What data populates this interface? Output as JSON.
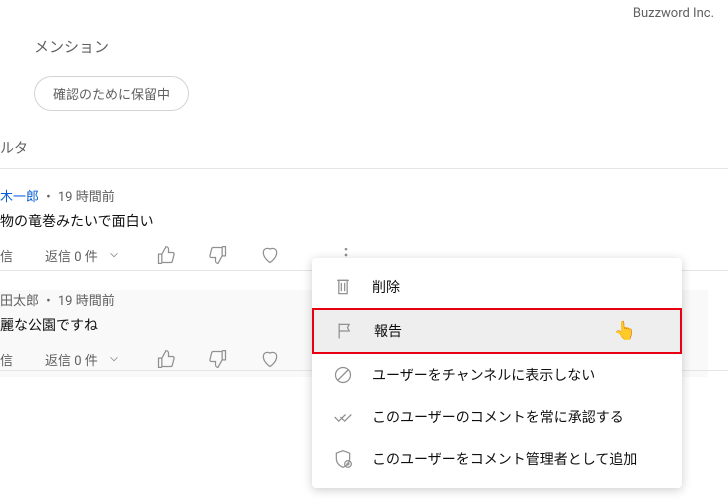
{
  "brand": "Buzzword Inc.",
  "tab": "メンション",
  "status_pill": "確認のために保留中",
  "filter_label": "ルタ",
  "comments": [
    {
      "author": "木一郎",
      "time": "19 時間前",
      "body": "物の竜巻みたいで面白い",
      "reply_label": "信",
      "replies_count": "返信 0 件"
    },
    {
      "author": "田太郎",
      "time": "19 時間前",
      "body": "麗な公園ですね",
      "reply_label": "信",
      "replies_count": "返信 0 件"
    }
  ],
  "dropdown": {
    "delete": "削除",
    "report": "報告",
    "hide_user": "ユーザーをチャンネルに表示しない",
    "always_approve": "このユーザーのコメントを常に承認する",
    "add_moderator": "このユーザーをコメント管理者として追加"
  }
}
